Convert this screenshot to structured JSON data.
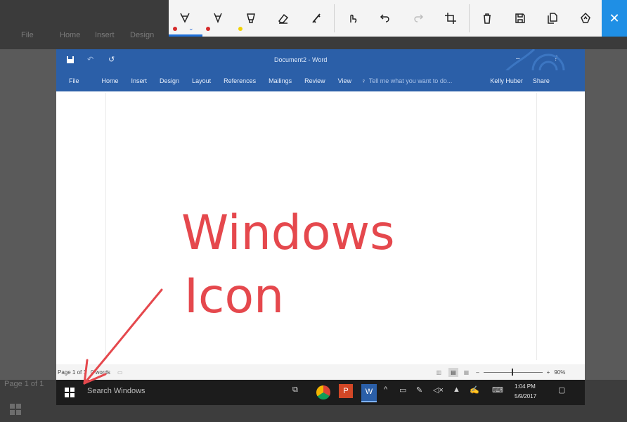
{
  "background": {
    "ghost_menu": [
      "File",
      "Home",
      "Insert",
      "Design"
    ],
    "ghost_status": "Page 1 of 1",
    "ghost_search": "Search Windows"
  },
  "toolbar": {
    "tools": [
      {
        "name": "ballpoint-pen",
        "color": "#d62b2b",
        "selected": true
      },
      {
        "name": "pencil",
        "color": "#d62b2b"
      },
      {
        "name": "highlighter",
        "color": "#f2d200"
      },
      {
        "name": "eraser"
      },
      {
        "name": "ruler"
      }
    ],
    "actions": [
      "touch-writing",
      "undo",
      "redo",
      "crop",
      "delete",
      "save",
      "copy",
      "share"
    ],
    "close_glyph": "✕"
  },
  "word": {
    "title": "Document2 - Word",
    "ribbon": [
      "File",
      "Home",
      "Insert",
      "Design",
      "Layout",
      "References",
      "Mailings",
      "Review",
      "View"
    ],
    "tell_me": "Tell me what you want to do...",
    "user": "Kelly Huber",
    "share": "Share",
    "status_page": "Page 1 of 1",
    "status_words": "0 words",
    "zoom": "90%"
  },
  "taskbar": {
    "search": "Search Windows",
    "time": "1:04 PM",
    "date": "5/9/2017"
  },
  "annotation": {
    "line1": "Windows",
    "line2": "Icon",
    "color": "#e5484d"
  }
}
